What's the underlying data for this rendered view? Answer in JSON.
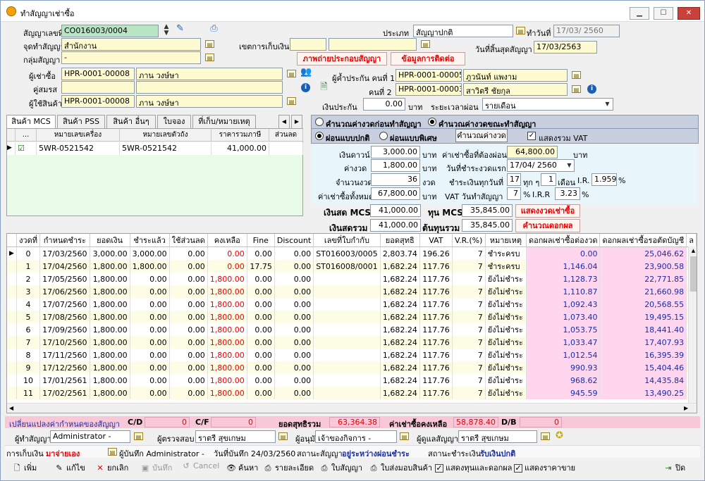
{
  "window": {
    "title": "ทำสัญญาเช่าซื้อ",
    "btn_min": "▁",
    "btn_max": "☐",
    "btn_close": "✕"
  },
  "header": {
    "contract_no_label": "สัญญาเลขที่",
    "contract_no": "CO016003/0004",
    "branch_label": "จุดทำสัญญา",
    "branch": "สำนักงาน",
    "group_label": "กลุ่มสัญญา",
    "group": "-",
    "type_label": "ประเภท",
    "type": "สัญญาปกติ",
    "made_date_label": "ทำวันที่",
    "made_date": "17/03/ 2560",
    "zone_label": "เขตการเก็บเงิน",
    "end_date_label": "วันที่สิ้นสุดสัญญา",
    "end_date": "17/03/2563",
    "btn_guarantor_photo": "ภาพถ่ายประกอบสัญญา",
    "btn_contact": "ข้อมูลการติดต่อ",
    "buyer_label": "ผู้เช่าซื้อ",
    "buyer_code": "HPR-0001-00008",
    "buyer_name": "ภาน วงษ์ษา",
    "spouse_label": "คู่สมรส",
    "user_label": "ผู้ใช้สินค้า",
    "user_code": "HPR-0001-00008",
    "user_name": "ภาน วงษ์ษา",
    "guar1_label": "ผู้ค้ำประกัน คนที่ 1",
    "guar1_code": "HPR-0001-00005",
    "guar1_name": "ภูวนันท์ แพงาม",
    "guar2_label": "คนที่ 2",
    "guar2_code": "HPR-0001-00003",
    "guar2_name": "สาวิตรี ชัยกุล",
    "deposit_label": "เงินประกัน",
    "deposit": "0.00",
    "baht": "บาท",
    "period_label": "ระยะเวลาผ่อน",
    "period": "รายเดือน"
  },
  "tabs": [
    {
      "label": "สินค้า MCS"
    },
    {
      "label": "สินค้า PSS"
    },
    {
      "label": "สินค้า อื่นๆ"
    },
    {
      "label": "ใบจอง"
    },
    {
      "label": "ที่เก็บ/หมายเหตุ"
    }
  ],
  "product_grid": {
    "headers": [
      "...",
      "หมายเลขเครื่อง",
      "หมายเลขตัวถัง",
      "ราคารวมภาษี",
      "ส่วนลด"
    ],
    "row": {
      "engine": "5WR-0521542",
      "body": "5WR-0521542",
      "price": "41,000.00"
    }
  },
  "calc": {
    "radio1": "คำนวณค่างวดก่อนทำสัญญา",
    "radio2": "คำนวณค่างวดขณะทำสัญญา",
    "radio3": "ผ่อนแบบปกติ",
    "radio4": "ผ่อนแบบพิเศษ",
    "btn_calc": "คำนวณค่างวด",
    "vat_chk": "แสดงรวม VAT",
    "down_label": "เงินดาวน์",
    "down": "3,000.00",
    "baht": "บาท",
    "hp_need_label": "ค่าเช่าซื้อที่ต้องผ่อน",
    "hp_need": "64,800.00",
    "inst_label": "ค่างวด",
    "inst": "1,800.00",
    "first_due_label": "วันที่ชำระงวดแรก",
    "first_due": "17/04/ 2560",
    "n_label": "จำนวนงวด",
    "n": "36",
    "unit_period": "งวด",
    "pay_every_label": "ชำระเงินทุกวันที่",
    "pay_day": "17",
    "every": "ทุก ๆ",
    "every_n": "1",
    "month": "เดือน",
    "ir_label": "I.R.",
    "ir": "1.959",
    "pct": "%",
    "total_label": "ค่าเช่าซื้อทั้งหมด",
    "total": "67,800.00",
    "vat_label": "VAT วันทำสัญญา",
    "vat": "7",
    "irr_label": "I.R.R",
    "irr": "3.23"
  },
  "cost": {
    "cash_mcs_label": "เงินสด MCS",
    "cash_mcs": "41,000.00",
    "cost_mcs_label": "ทุน MCS",
    "cost_mcs": "35,845.00",
    "btn_show": "แสดงงวดเช่าซื้อ",
    "cash_total_label": "เงินสดรวม",
    "cash_total": "41,000.00",
    "cost_total_label": "ต้นทุนรวม",
    "cost_total": "35,845.00",
    "btn_interest": "คำนวณดอกผล"
  },
  "schedule": {
    "headers": [
      "งวดที่",
      "กำหนดชำระ",
      "ยอดเงิน",
      "ชำระแล้ว",
      "ใช้ส่วนลด",
      "คงเหลือ",
      "Fine",
      "Discount",
      "เลขที่ใบกำกับ",
      "ยอดสุทธิ",
      "VAT",
      "V.R.(%)",
      "หมายเหตุ",
      "ดอกผลเช่าซื้อต่องวด",
      "ดอกผลเช่าซื้อรอตัดบัญชี",
      "ล"
    ],
    "rows": [
      [
        "0",
        "17/03/2560",
        "3,000.00",
        "3,000.00",
        "0.00",
        "0.00",
        "0.00",
        "0.00",
        "ST016003/0005",
        "2,803.74",
        "196.26",
        "7",
        "ชำระครบ",
        "0.00",
        "25,046.62"
      ],
      [
        "1",
        "17/04/2560",
        "1,800.00",
        "1,800.00",
        "0.00",
        "0.00",
        "17.75",
        "0.00",
        "ST016008/0001",
        "1,682.24",
        "117.76",
        "7",
        "ชำระครบ",
        "1,146.04",
        "23,900.58"
      ],
      [
        "2",
        "17/05/2560",
        "1,800.00",
        "0.00",
        "0.00",
        "1,800.00",
        "0.00",
        "0.00",
        "",
        "1,682.24",
        "117.76",
        "7",
        "ยังไม่ชำระ",
        "1,128.73",
        "22,771.85"
      ],
      [
        "3",
        "17/06/2560",
        "1,800.00",
        "0.00",
        "0.00",
        "1,800.00",
        "0.00",
        "0.00",
        "",
        "1,682.24",
        "117.76",
        "7",
        "ยังไม่ชำระ",
        "1,110.87",
        "21,660.98"
      ],
      [
        "4",
        "17/07/2560",
        "1,800.00",
        "0.00",
        "0.00",
        "1,800.00",
        "0.00",
        "0.00",
        "",
        "1,682.24",
        "117.76",
        "7",
        "ยังไม่ชำระ",
        "1,092.43",
        "20,568.55"
      ],
      [
        "5",
        "17/08/2560",
        "1,800.00",
        "0.00",
        "0.00",
        "1,800.00",
        "0.00",
        "0.00",
        "",
        "1,682.24",
        "117.76",
        "7",
        "ยังไม่ชำระ",
        "1,073.40",
        "19,495.15"
      ],
      [
        "6",
        "17/09/2560",
        "1,800.00",
        "0.00",
        "0.00",
        "1,800.00",
        "0.00",
        "0.00",
        "",
        "1,682.24",
        "117.76",
        "7",
        "ยังไม่ชำระ",
        "1,053.75",
        "18,441.40"
      ],
      [
        "7",
        "17/10/2560",
        "1,800.00",
        "0.00",
        "0.00",
        "1,800.00",
        "0.00",
        "0.00",
        "",
        "1,682.24",
        "117.76",
        "7",
        "ยังไม่ชำระ",
        "1,033.47",
        "17,407.93"
      ],
      [
        "8",
        "17/11/2560",
        "1,800.00",
        "0.00",
        "0.00",
        "1,800.00",
        "0.00",
        "0.00",
        "",
        "1,682.24",
        "117.76",
        "7",
        "ยังไม่ชำระ",
        "1,012.54",
        "16,395.39"
      ],
      [
        "9",
        "17/12/2560",
        "1,800.00",
        "0.00",
        "0.00",
        "1,800.00",
        "0.00",
        "0.00",
        "",
        "1,682.24",
        "117.76",
        "7",
        "ยังไม่ชำระ",
        "990.93",
        "15,404.46"
      ],
      [
        "10",
        "17/01/2561",
        "1,800.00",
        "0.00",
        "0.00",
        "1,800.00",
        "0.00",
        "0.00",
        "",
        "1,682.24",
        "117.76",
        "7",
        "ยังไม่ชำระ",
        "968.62",
        "14,435.84"
      ],
      [
        "11",
        "17/02/2561",
        "1,800.00",
        "0.00",
        "0.00",
        "1,800.00",
        "0.00",
        "0.00",
        "",
        "1,682.24",
        "117.76",
        "7",
        "ยังไม่ชำระ",
        "945.59",
        "13,490.25"
      ]
    ]
  },
  "summary": {
    "change_label": "เปลี่ยนแปลงค่ากำหนดของสัญญา",
    "cd_label": "C/D",
    "cd": "0",
    "cf_label": "C/F",
    "cf": "0",
    "net_label": "ยอดสุทธิรวม",
    "net": "63,364.38",
    "remain_label": "ค่าเช่าซื้อคงเหลือ",
    "remain": "58,878.40",
    "db_label": "D/B",
    "db": "0"
  },
  "people": {
    "maker_label": "ผู้ทำสัญญา",
    "maker": "Administrator -",
    "checker_label": "ผู้ตรวจสอบ",
    "checker": "ราตรี สุขเกษม",
    "approver_label": "ผู้อนุมัติ",
    "approver": "เจ้าของกิจการ -",
    "caretaker_label": "ผู้ดูแลสัญญา",
    "caretaker": "ราตรี สุขเกษม"
  },
  "status": {
    "collect_label": "การเก็บเงิน",
    "collect": "มาจ่ายเอง",
    "recorder": "ผู้บันทึก Administrator -",
    "rec_date": "วันที่บันทึก 24/03/2560",
    "state_label": "สถานะสัญญา",
    "state": "อยู่ระหว่างผ่อนชำระ",
    "pay_state_label": "สถานะชำระเงิน",
    "pay_state": "รับเงินปกติ"
  },
  "toolbar": {
    "add": "เพิ่ม",
    "edit": "แก้ไข",
    "cancel": "ยกเลิก",
    "save": "บันทึก",
    "cancel2": "Cancel",
    "search": "ค้นหา",
    "detail": "รายละเอียด",
    "contract": "ใบสัญญา",
    "delivery": "ใบส่งมอบสินค้า",
    "show_cost": "แสดงทุนและดอกผล",
    "show_price": "แสดงราคาขาย",
    "close": "ปิด"
  }
}
